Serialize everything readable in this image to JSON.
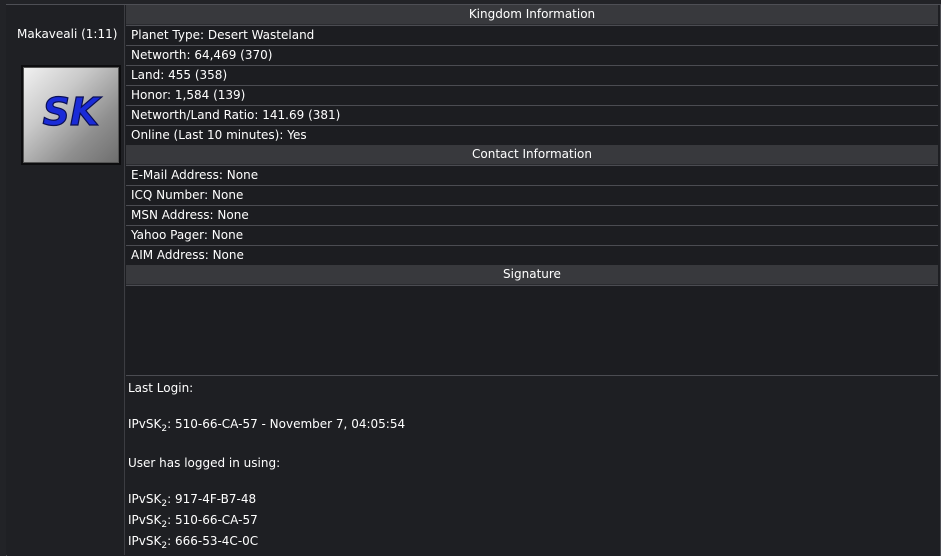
{
  "player": {
    "name": "Makaveali (1:11)",
    "avatar_text": "SK"
  },
  "kingdom": {
    "header": "Kingdom Information",
    "rows": [
      {
        "label": "Planet Type:",
        "value": "Desert Wasteland"
      },
      {
        "label": "Networth:",
        "value": "64,469 (370)"
      },
      {
        "label": "Land:",
        "value": "455 (358)"
      },
      {
        "label": "Honor:",
        "value": "1,584 (139)"
      },
      {
        "label": "Networth/Land Ratio:",
        "value": "141.69 (381)"
      },
      {
        "label": "Online (Last 10 minutes):",
        "value": "Yes"
      }
    ]
  },
  "contact": {
    "header": "Contact Information",
    "rows": [
      {
        "label": "E-Mail Address:",
        "value": "None"
      },
      {
        "label": "ICQ Number:",
        "value": "None"
      },
      {
        "label": "MSN Address:",
        "value": "None"
      },
      {
        "label": "Yahoo Pager:",
        "value": "None"
      },
      {
        "label": "AIM Address:",
        "value": "None"
      }
    ]
  },
  "signature": {
    "header": "Signature",
    "text": ""
  },
  "login": {
    "last_login_label": "Last Login:",
    "ip_prefix": "IPvSK",
    "ip_sub": "2",
    "last_login_value": ": 510-66-CA-57 - November 7, 04:05:54",
    "used_label": "User has logged in using:",
    "used": [
      ": 917-4F-B7-48",
      ": 510-66-CA-57",
      ": 666-53-4C-0C"
    ]
  },
  "colors": {
    "background": "#222327",
    "header_bg": "#38393d",
    "row_bg": "#1c1d21",
    "border": "#4b4c52",
    "avatar_text": "#1a2bd8"
  }
}
